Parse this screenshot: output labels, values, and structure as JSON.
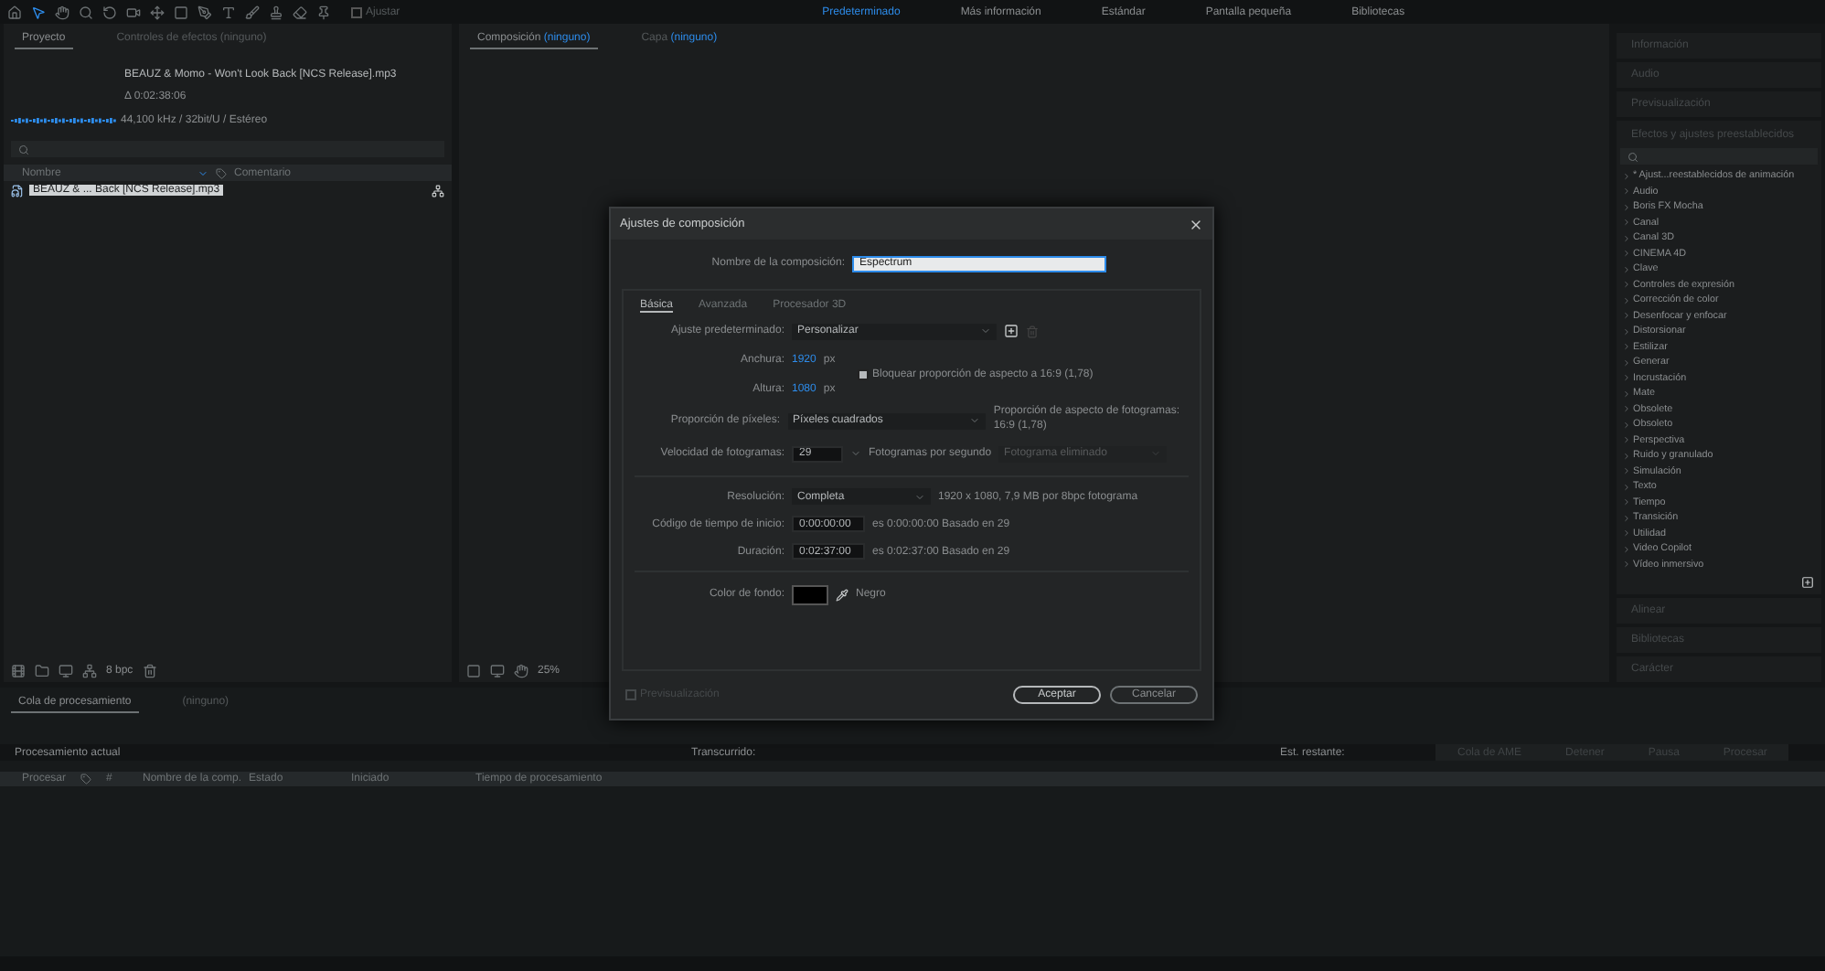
{
  "toolbar": {
    "snap": {
      "label": "Ajustar",
      "checked": false
    },
    "workspaces": [
      {
        "label": "Predeterminado",
        "selected": true
      },
      {
        "label": "Más información",
        "selected": false
      },
      {
        "label": "Estándar",
        "selected": false
      },
      {
        "label": "Pantalla pequeña",
        "selected": false
      },
      {
        "label": "Bibliotecas",
        "selected": false
      }
    ]
  },
  "project_panel": {
    "tabs": [
      {
        "label": "Proyecto",
        "selected": true
      },
      {
        "label": "Controles de efectos (ninguno)",
        "selected": false
      }
    ],
    "file": {
      "name": "BEAUZ & Momo - Won't Look Back [NCS Release].mp3",
      "duration": "Δ 0:02:38:06",
      "audio_info": "44,100 kHz / 32bit/U / Estéreo"
    },
    "columns": [
      "Nombre",
      "Comentario"
    ],
    "items": [
      {
        "name": "BEAUZ & ... Back [NCS Release].mp3",
        "selected": true
      }
    ],
    "bpc": "8 bpc"
  },
  "viewer": {
    "tabs": [
      {
        "label": "Composición",
        "target": "(ninguno)",
        "selected": true
      },
      {
        "label": "Capa",
        "target": "(ninguno)",
        "selected": false
      }
    ],
    "zoom": "25%"
  },
  "right_panel": {
    "top_sections": [
      "Información",
      "Audio",
      "Previsualización"
    ],
    "effects": {
      "title": "Efectos y ajustes preestablecidos",
      "items": [
        {
          "label": "* Ajust...reestablecidos de animación",
          "expanded": false
        },
        {
          "label": "Audio",
          "expanded": false
        },
        {
          "label": "Boris FX Mocha",
          "expanded": false
        },
        {
          "label": "Canal",
          "expanded": false
        },
        {
          "label": "Canal 3D",
          "expanded": false
        },
        {
          "label": "CINEMA 4D",
          "expanded": false
        },
        {
          "label": "Clave",
          "expanded": false
        },
        {
          "label": "Controles de expresión",
          "expanded": false
        },
        {
          "label": "Corrección de color",
          "expanded": false
        },
        {
          "label": "Desenfocar y enfocar",
          "expanded": false
        },
        {
          "label": "Distorsionar",
          "expanded": false
        },
        {
          "label": "Estilizar",
          "expanded": false
        },
        {
          "label": "Generar",
          "expanded": false
        },
        {
          "label": "Incrustación",
          "expanded": false
        },
        {
          "label": "Mate",
          "expanded": false
        },
        {
          "label": "Obsolete",
          "expanded": false
        },
        {
          "label": "Obsoleto",
          "expanded": false
        },
        {
          "label": "Perspectiva",
          "expanded": false
        },
        {
          "label": "Ruido y granulado",
          "expanded": false
        },
        {
          "label": "Simulación",
          "expanded": false
        },
        {
          "label": "Texto",
          "expanded": false
        },
        {
          "label": "Tiempo",
          "expanded": false
        },
        {
          "label": "Transición",
          "expanded": false
        },
        {
          "label": "Utilidad",
          "expanded": false
        },
        {
          "label": "Video Copilot",
          "expanded": false
        },
        {
          "label": "Vídeo inmersivo",
          "expanded": false
        }
      ]
    },
    "bottom_sections": [
      "Alinear",
      "Bibliotecas",
      "Carácter"
    ]
  },
  "render_queue": {
    "tabs": [
      {
        "label": "Cola de procesamiento",
        "selected": true
      },
      {
        "label": "(ninguno)",
        "selected": false
      }
    ],
    "current": "Procesamiento actual",
    "elapsed": "Transcurrido:",
    "remaining": "Est. restante:",
    "buttons": [
      "Cola de AME",
      "Detener",
      "Pausa",
      "Procesar"
    ],
    "columns": [
      "Procesar",
      "#",
      "Nombre de la comp.",
      "Estado",
      "Iniciado",
      "Tiempo de procesamiento"
    ]
  },
  "dialog": {
    "title": "Ajustes de composición",
    "name_label": "Nombre de la composición:",
    "name_value": "Espectrum",
    "tabs": [
      {
        "label": "Básica",
        "selected": true
      },
      {
        "label": "Avanzada",
        "selected": false
      },
      {
        "label": "Procesador 3D",
        "selected": false
      }
    ],
    "preset": {
      "label": "Ajuste predeterminado:",
      "value": "Personalizar"
    },
    "width": {
      "label": "Anchura:",
      "value": "1920",
      "unit": "px"
    },
    "height": {
      "label": "Altura:",
      "value": "1080",
      "unit": "px"
    },
    "lock": {
      "label": "Bloquear proporción de aspecto a 16:9 (1,78)",
      "checked": true
    },
    "pixel_aspect": {
      "label": "Proporción de píxeles:",
      "value": "Píxeles cuadrados",
      "note": "Proporción de aspecto de fotogramas: 16:9 (1,78)"
    },
    "frame_rate": {
      "label": "Velocidad de fotogramas:",
      "value": "29",
      "unit": "Fotogramas por segundo",
      "drop": "Fotograma eliminado"
    },
    "resolution": {
      "label": "Resolución:",
      "value": "Completa",
      "note": "1920 x 1080, 7,9 MB por 8bpc fotograma"
    },
    "start": {
      "label": "Código de tiempo de inicio:",
      "value": "0:00:00:00",
      "note": "es 0:00:00:00  Basado en 29"
    },
    "duration": {
      "label": "Duración:",
      "value": "0:02:37:00",
      "note": "es 0:02:37:00  Basado en 29"
    },
    "background": {
      "label": "Color de fondo:",
      "color": "#000000",
      "name": "Negro"
    },
    "preview": {
      "label": "Previsualización",
      "checked": false
    },
    "buttons": [
      {
        "label": "Aceptar",
        "kind": "primary"
      },
      {
        "label": "Cancelar",
        "kind": "secondary"
      }
    ]
  }
}
